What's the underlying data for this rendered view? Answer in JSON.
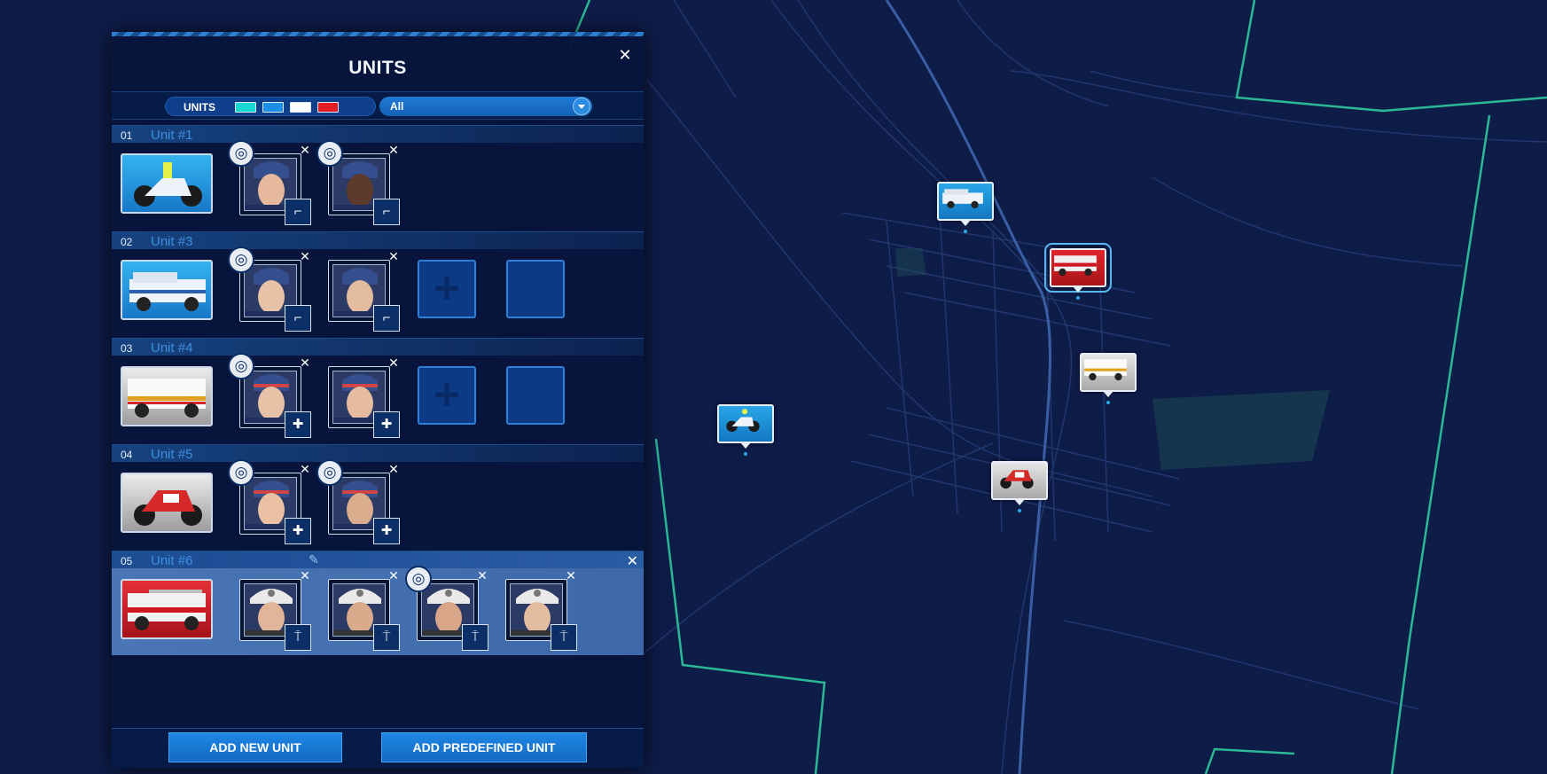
{
  "panel": {
    "title": "UNITS",
    "filter": {
      "label": "UNITS",
      "swatches": [
        "#18d6d0",
        "#1b8ee6",
        "#ffffff",
        "#e11e26"
      ],
      "select_value": "All"
    },
    "units": [
      {
        "num": "01",
        "name": "Unit #1",
        "vehicle": "police-motorcycle",
        "vehicle_color": "blue",
        "crew": [
          {
            "badge": "gun-icon",
            "driver": true
          },
          {
            "badge": "gun-icon",
            "driver": true
          }
        ],
        "empty_slots": 0,
        "add_slot": false
      },
      {
        "num": "02",
        "name": "Unit #3",
        "vehicle": "police-van",
        "vehicle_color": "blue",
        "crew": [
          {
            "badge": "gun-icon",
            "driver": true
          },
          {
            "badge": "gun-icon",
            "driver": false
          }
        ],
        "add_slot": true,
        "empty_slots": 1
      },
      {
        "num": "03",
        "name": "Unit #4",
        "vehicle": "ambulance",
        "vehicle_color": "white",
        "crew": [
          {
            "badge": "medkit-icon",
            "driver": true
          },
          {
            "badge": "medkit-icon",
            "driver": false
          }
        ],
        "add_slot": true,
        "empty_slots": 1
      },
      {
        "num": "04",
        "name": "Unit #5",
        "vehicle": "ambulance-motorcycle",
        "vehicle_color": "white",
        "crew": [
          {
            "badge": "medkit-icon",
            "driver": true
          },
          {
            "badge": "medkit-icon",
            "driver": true
          }
        ],
        "add_slot": false,
        "empty_slots": 0
      },
      {
        "num": "05",
        "name": "Unit #6",
        "vehicle": "fire-truck",
        "vehicle_color": "red",
        "selected": true,
        "crew": [
          {
            "badge": "extinguisher-icon",
            "driver": false
          },
          {
            "badge": "extinguisher-icon",
            "driver": false
          },
          {
            "badge": "extinguisher-icon",
            "driver": true
          },
          {
            "badge": "extinguisher-icon",
            "driver": false
          }
        ],
        "add_slot": false,
        "empty_slots": 0
      }
    ],
    "buttons": {
      "add_new": "ADD NEW UNIT",
      "add_predefined": "ADD PREDEFINED UNIT"
    }
  },
  "map": {
    "markers": [
      {
        "vehicle": "police-van",
        "color": "blue"
      },
      {
        "vehicle": "fire-truck",
        "color": "red",
        "selected": true
      },
      {
        "vehicle": "ambulance",
        "color": "white"
      },
      {
        "vehicle": "police-motorcycle",
        "color": "blue"
      },
      {
        "vehicle": "ambulance-motorcycle",
        "color": "white"
      }
    ]
  }
}
